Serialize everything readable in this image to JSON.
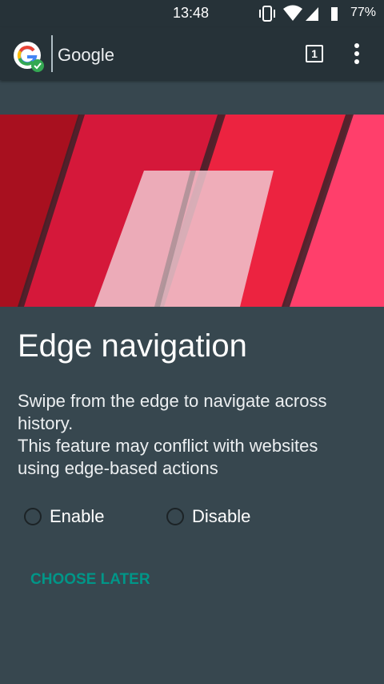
{
  "status_bar": {
    "time": "13:48",
    "battery_text": "77%",
    "icons": [
      "vibrate-icon",
      "wifi-icon",
      "signal-icon",
      "battery-icon"
    ]
  },
  "toolbar": {
    "title": "Google",
    "tab_count": "1",
    "logo_icon": "google-g-icon",
    "menu_icon": "more-vert-icon"
  },
  "dialog": {
    "title": "Edge navigation",
    "description_lines": [
      "Swipe from the edge to navigate across",
      "history.",
      "This feature may conflict with websites",
      "using edge-based actions"
    ],
    "options": [
      {
        "label": "Enable",
        "selected": false
      },
      {
        "label": "Disable",
        "selected": false
      }
    ],
    "choose_later": "CHOOSE LATER"
  },
  "colors": {
    "background": "#37474f",
    "toolbar": "#263238",
    "accent": "#009688",
    "hero_dark_red": "#a8101f",
    "hero_red": "#d5183a",
    "hero_bright_red": "#ec2340",
    "hero_pink": "#ff3f6b"
  }
}
